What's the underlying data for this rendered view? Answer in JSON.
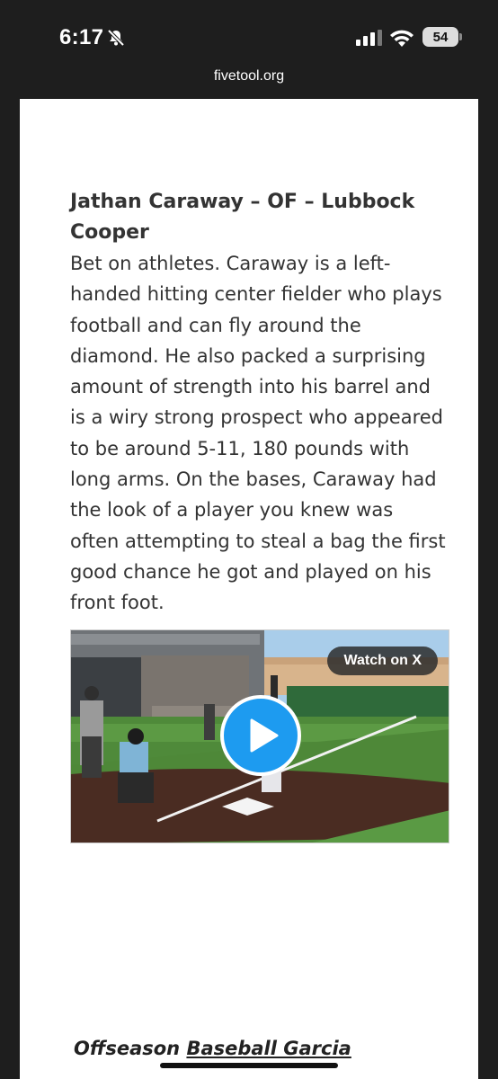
{
  "status_bar": {
    "time": "6:17",
    "battery_level": "54",
    "icons": [
      "bell-slash-icon",
      "signal-icon",
      "wifi-icon",
      "battery-icon"
    ]
  },
  "browser": {
    "url": "fivetool.org"
  },
  "article": {
    "title": "Jathan Caraway – OF – Lubbock Cooper",
    "body": "Bet on athletes. Caraway is a left-handed hitting center fielder who plays football and can fly around the diamond. He also packed a surprising amount of strength into his barrel and is a wiry strong prospect who appeared to be around 5-11, 180 pounds with long arms. On the bases, Caraway had the look of a player you knew was often attempting to steal a bag the first good chance he got and played on his front foot."
  },
  "video": {
    "watch_label": "Watch on X",
    "play_icon": "play-icon",
    "accent_color": "#1d9bf0"
  },
  "footer": {
    "link_part1": "Offseason",
    "link_part2": "Baseball Garcia"
  }
}
